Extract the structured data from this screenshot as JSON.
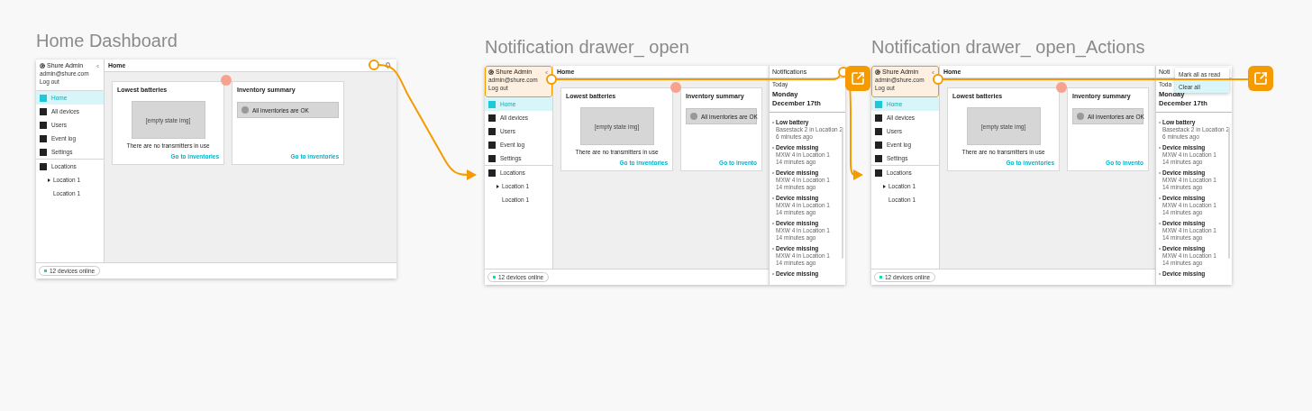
{
  "artboards": [
    {
      "title": "Home Dashboard",
      "sidebar": {
        "user": {
          "name": "Shure Admin",
          "email": "admin@shure.com",
          "logout": "Log out",
          "highlighted": false
        },
        "nav": [
          {
            "label": "Home",
            "selected": true
          },
          {
            "label": "All devices",
            "selected": false
          },
          {
            "label": "Users",
            "selected": false
          },
          {
            "label": "Event log",
            "selected": false
          },
          {
            "label": "Settings",
            "selected": false
          }
        ],
        "locations": {
          "label": "Locations",
          "children": [
            {
              "label": "Location 1",
              "expandable": true
            },
            {
              "label": "Location 1",
              "expandable": false
            }
          ]
        }
      },
      "header": {
        "title": "Home"
      },
      "cards": [
        {
          "kind": "empty",
          "title": "Lowest batteries",
          "image_label": "[empty state img]",
          "message": "There are no transmitters in use",
          "link": "Go to inventories"
        },
        {
          "kind": "status",
          "title": "Inventory summary",
          "status": "All inventories are OK",
          "link": "Go to inventories"
        }
      ],
      "status_bar": {
        "label": "12 devices online"
      }
    },
    {
      "title": "Notification drawer_ open",
      "sidebar": {
        "user": {
          "name": "Shure Admin",
          "email": "admin@shure.com",
          "logout": "Log out",
          "highlighted": true
        },
        "nav": [
          {
            "label": "Home",
            "selected": true
          },
          {
            "label": "All devices",
            "selected": false
          },
          {
            "label": "Users",
            "selected": false
          },
          {
            "label": "Event log",
            "selected": false
          },
          {
            "label": "Settings",
            "selected": false
          }
        ],
        "locations": {
          "label": "Locations",
          "children": [
            {
              "label": "Location 1",
              "expandable": true
            },
            {
              "label": "Location 1",
              "expandable": false
            }
          ]
        }
      },
      "header": {
        "title": "Home"
      },
      "cards": [
        {
          "kind": "empty",
          "title": "Lowest batteries",
          "image_label": "[empty state img]",
          "message": "There are no transmitters in use",
          "link": "Go to inventories"
        },
        {
          "kind": "status",
          "title": "Inventory summary",
          "status": "All inventories are OK",
          "link": "Go to invento"
        }
      ],
      "status_bar": {
        "label": "12 devices online"
      },
      "drawer": {
        "title": "Notifications",
        "day": "Today",
        "date": "Monday December 17th",
        "items": [
          {
            "title": "Low battery",
            "detail": "Basestack 2 in Location 2",
            "time": "6 minutes ago"
          },
          {
            "title": "Device missing",
            "detail": "MXW 4 in Location 1",
            "time": "14 minutes ago"
          },
          {
            "title": "Device missing",
            "detail": "MXW 4 in Location 1",
            "time": "14 minutes ago"
          },
          {
            "title": "Device missing",
            "detail": "MXW 4 in Location 1",
            "time": "14 minutes ago"
          },
          {
            "title": "Device missing",
            "detail": "MXW 4 in Location 1",
            "time": "14 minutes ago"
          },
          {
            "title": "Device missing",
            "detail": "MXW 4 in Location 1",
            "time": "14 minutes ago"
          },
          {
            "title": "Device missing"
          }
        ]
      }
    },
    {
      "title": "Notification drawer_ open_Actions",
      "sidebar": {
        "user": {
          "name": "Shure Admin",
          "email": "admin@shure.com",
          "logout": "Log out",
          "highlighted": true
        },
        "nav": [
          {
            "label": "Home",
            "selected": true
          },
          {
            "label": "All devices",
            "selected": false
          },
          {
            "label": "Users",
            "selected": false
          },
          {
            "label": "Event log",
            "selected": false
          },
          {
            "label": "Settings",
            "selected": false
          }
        ],
        "locations": {
          "label": "Locations",
          "children": [
            {
              "label": "Location 1",
              "expandable": true
            },
            {
              "label": "Location 1",
              "expandable": false
            }
          ]
        }
      },
      "header": {
        "title": "Home"
      },
      "cards": [
        {
          "kind": "empty",
          "title": "Lowest batteries",
          "image_label": "[empty state img]",
          "message": "There are no transmitters in use",
          "link": "Go to inventories"
        },
        {
          "kind": "status",
          "title": "Inventory summary",
          "status": "All inventories are OK",
          "link": "Go to invento"
        }
      ],
      "status_bar": {
        "label": "12 devices online"
      },
      "drawer": {
        "title": "Noti",
        "day": "Toda",
        "date": "Monday December 17th",
        "items": [
          {
            "title": "Low battery",
            "detail": "Basestack 2 in Location 2",
            "time": "6 minutes ago"
          },
          {
            "title": "Device missing",
            "detail": "MXW 4 in Location 1",
            "time": "14 minutes ago"
          },
          {
            "title": "Device missing",
            "detail": "MXW 4 in Location 1",
            "time": "14 minutes ago"
          },
          {
            "title": "Device missing",
            "detail": "MXW 4 in Location 1",
            "time": "14 minutes ago"
          },
          {
            "title": "Device missing",
            "detail": "MXW 4 in Location 1",
            "time": "14 minutes ago"
          },
          {
            "title": "Device missing",
            "detail": "MXW 4 in Location 1",
            "time": "14 minutes ago"
          },
          {
            "title": "Device missing"
          }
        ],
        "menu": [
          {
            "label": "Mark all as read",
            "selected": false
          },
          {
            "label": "Clear all",
            "selected": true
          }
        ]
      }
    }
  ]
}
